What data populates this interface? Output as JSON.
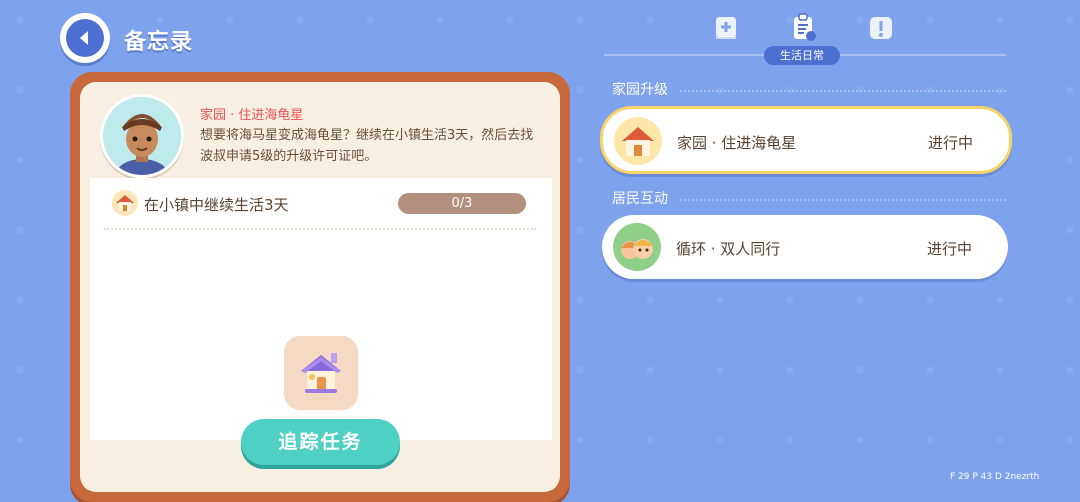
{
  "header": {
    "title": "备忘录"
  },
  "tabs": {
    "active_label": "生活日常",
    "icons": [
      "guide-book-icon",
      "task-clipboard-icon",
      "quest-note-icon"
    ]
  },
  "quest_detail": {
    "title": "家园 · 住进海龟星",
    "description": "想要将海马星变成海龟星？继续在小镇生活3天，然后去找波叔申请5级的升级许可证吧。",
    "task": {
      "label": "在小镇中继续生活3天",
      "progress": "0/3",
      "progress_value": 0
    },
    "track_button": "追踪任务"
  },
  "sections": [
    {
      "label": "家园升级",
      "items": [
        {
          "name": "家园 · 住进海龟星",
          "status": "进行中",
          "icon": "house-icon",
          "selected": true
        }
      ]
    },
    {
      "label": "居民互动",
      "items": [
        {
          "name": "循环 · 双人同行",
          "status": "进行中",
          "icon": "two-residents-icon",
          "selected": false
        }
      ]
    }
  ],
  "debug": "F 29   P 43   D 2nezrth",
  "colors": {
    "background": "#7fa2ec",
    "accent_blue": "#4d6fd2",
    "button_teal": "#4fd0c4",
    "frame_orange": "#c8683c",
    "highlight": "#f8d36a"
  }
}
